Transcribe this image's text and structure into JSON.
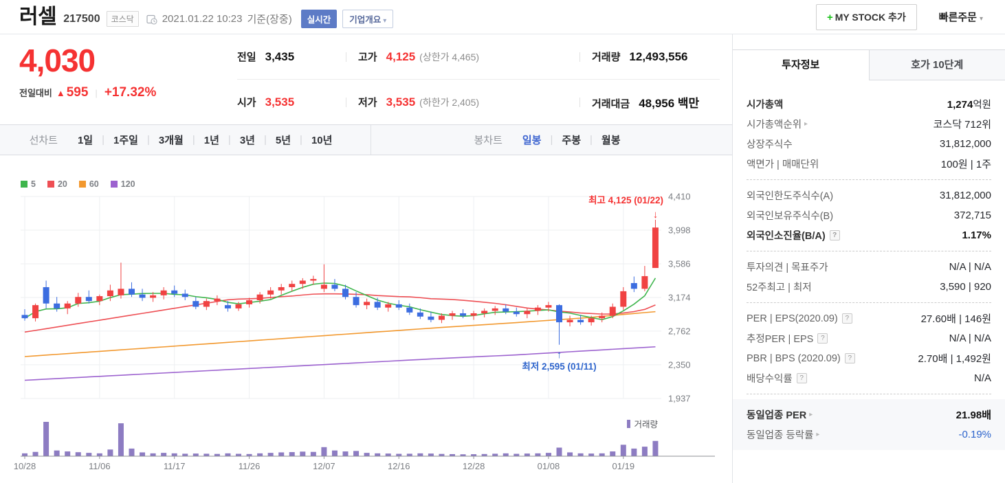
{
  "glyphs": {
    "caret": "▾",
    "plus": "+",
    "up_triangle": "▲",
    "pipe": "|",
    "arrow_right": "▸",
    "help": "?",
    "down_arrow": "↓",
    "up_arrow": "↑"
  },
  "header": {
    "stock_name": "러셀",
    "stock_code": "217500",
    "market_badge": "코스닥",
    "timestamp": "2021.01.22 10:23",
    "basis_label": "기준(장중)",
    "realtime_label": "실시간",
    "company_overview_label": "기업개요",
    "my_stock_label": "MY STOCK 추가",
    "quick_order_label": "빠른주문"
  },
  "price": {
    "current": "4,030",
    "change_label": "전일대비",
    "change_value": "595",
    "change_percent": "+17.32%",
    "color": "#f53232"
  },
  "summary": {
    "rows": [
      [
        {
          "key": "prev-close",
          "label": "전일",
          "value": "3,435",
          "tone": "dark"
        },
        {
          "key": "high",
          "label": "고가",
          "value": "4,125",
          "tone": "red",
          "extra": "(상한가 4,465)"
        },
        {
          "key": "volume",
          "label": "거래량",
          "value": "12,493,556",
          "tone": "dark"
        }
      ],
      [
        {
          "key": "open",
          "label": "시가",
          "value": "3,535",
          "tone": "red"
        },
        {
          "key": "low",
          "label": "저가",
          "value": "3,535",
          "tone": "red",
          "extra": "(하한가 2,405)"
        },
        {
          "key": "trade-value",
          "label": "거래대금",
          "value": "48,956 백만",
          "tone": "dark"
        }
      ]
    ]
  },
  "chart_tabs": {
    "period_group_label": "선차트",
    "periods": [
      "1일",
      "1주일",
      "3개월",
      "1년",
      "3년",
      "5년",
      "10년"
    ],
    "candle_group_label": "봉차트",
    "candle_types": [
      {
        "label": "일봉",
        "active": true
      },
      {
        "label": "주봉"
      },
      {
        "label": "월봉"
      }
    ]
  },
  "chart_data": {
    "type": "candlestick+volume",
    "title": "러셀 일봉 차트",
    "price_range": [
      1937,
      4410
    ],
    "y_ticks": [
      "4,410",
      "3,998",
      "3,586",
      "3,174",
      "2,762",
      "2,350",
      "1,937"
    ],
    "y_tick_values": [
      4410,
      3998,
      3586,
      3174,
      2762,
      2350,
      1937
    ],
    "x_ticks": [
      {
        "label": "10/28",
        "i": 0
      },
      {
        "label": "11/06",
        "i": 7
      },
      {
        "label": "11/17",
        "i": 14
      },
      {
        "label": "11/26",
        "i": 21
      },
      {
        "label": "12/07",
        "i": 28
      },
      {
        "label": "12/16",
        "i": 35
      },
      {
        "label": "12/28",
        "i": 42
      },
      {
        "label": "01/08",
        "i": 49
      },
      {
        "label": "01/19",
        "i": 56
      }
    ],
    "legend": [
      {
        "label": "5",
        "color": "#3eb54c"
      },
      {
        "label": "20",
        "color": "#ee4f54"
      },
      {
        "label": "60",
        "color": "#f2982e"
      },
      {
        "label": "120",
        "color": "#9c62cf"
      }
    ],
    "volume_legend": "거래량",
    "volume_color": "#8d7cc2",
    "up_color": "#f04242",
    "down_color": "#3c6de0",
    "ma20_start": 2750,
    "ma60_control": [
      2450,
      2510,
      2570,
      2630,
      2690,
      2750,
      2810,
      2865,
      2925,
      3000
    ],
    "ma120_control": [
      2160,
      2205,
      2250,
      2295,
      2340,
      2385,
      2430,
      2470,
      2520,
      2570
    ],
    "annotations": {
      "high": {
        "label": "최고 4,125 (01/22)",
        "index": 59,
        "price": 4125,
        "color": "#f53232"
      },
      "low": {
        "label": "최저 2,595 (01/11)",
        "index": 50,
        "price": 2595,
        "color": "#2d64cc"
      }
    },
    "candles": [
      [
        "10/28",
        2960,
        3030,
        2890,
        2920,
        300
      ],
      [
        "10/29",
        2920,
        3100,
        2880,
        3080,
        450
      ],
      [
        "10/30",
        3300,
        3380,
        3040,
        3100,
        3600
      ],
      [
        "11/02",
        3100,
        3180,
        3000,
        3040,
        600
      ],
      [
        "11/03",
        3040,
        3130,
        2970,
        3100,
        500
      ],
      [
        "11/04",
        3100,
        3230,
        3060,
        3180,
        420
      ],
      [
        "11/05",
        3180,
        3260,
        3100,
        3130,
        350
      ],
      [
        "11/06",
        3130,
        3210,
        3080,
        3190,
        300
      ],
      [
        "11/09",
        3190,
        3330,
        3130,
        3260,
        700
      ],
      [
        "11/10",
        3200,
        3600,
        3160,
        3280,
        3450
      ],
      [
        "11/11",
        3280,
        3360,
        3180,
        3210,
        800
      ],
      [
        "11/12",
        3210,
        3280,
        3130,
        3170,
        400
      ],
      [
        "11/13",
        3170,
        3240,
        3120,
        3200,
        300
      ],
      [
        "11/16",
        3200,
        3300,
        3150,
        3260,
        350
      ],
      [
        "11/17",
        3260,
        3320,
        3180,
        3220,
        300
      ],
      [
        "11/18",
        3220,
        3270,
        3140,
        3180,
        260
      ],
      [
        "11/19",
        3130,
        3180,
        3030,
        3060,
        280
      ],
      [
        "11/20",
        3060,
        3160,
        3020,
        3130,
        260
      ],
      [
        "11/23",
        3130,
        3200,
        3080,
        3160,
        240
      ],
      [
        "11/24",
        3080,
        3130,
        3000,
        3040,
        300
      ],
      [
        "11/25",
        3040,
        3120,
        3010,
        3090,
        250
      ],
      [
        "11/26",
        3090,
        3170,
        3050,
        3140,
        230
      ],
      [
        "11/27",
        3140,
        3240,
        3100,
        3210,
        300
      ],
      [
        "11/30",
        3210,
        3300,
        3160,
        3260,
        350
      ],
      [
        "12/01",
        3260,
        3340,
        3210,
        3300,
        400
      ],
      [
        "12/02",
        3300,
        3380,
        3250,
        3340,
        430
      ],
      [
        "12/03",
        3340,
        3410,
        3280,
        3380,
        480
      ],
      [
        "12/04",
        3380,
        3440,
        3330,
        3400,
        450
      ],
      [
        "12/07",
        3280,
        3580,
        3240,
        3330,
        950
      ],
      [
        "12/08",
        3330,
        3400,
        3250,
        3280,
        600
      ],
      [
        "12/09",
        3280,
        3330,
        3150,
        3180,
        500
      ],
      [
        "12/10",
        3180,
        3240,
        3050,
        3080,
        550
      ],
      [
        "12/11",
        3080,
        3160,
        3030,
        3120,
        350
      ],
      [
        "12/14",
        3120,
        3170,
        3020,
        3050,
        300
      ],
      [
        "12/15",
        3050,
        3120,
        3000,
        3090,
        280
      ],
      [
        "12/16",
        3090,
        3140,
        3020,
        3050,
        250
      ],
      [
        "12/17",
        3050,
        3100,
        2960,
        2990,
        260
      ],
      [
        "12/18",
        2990,
        3040,
        2910,
        2940,
        300
      ],
      [
        "12/21",
        2940,
        3000,
        2870,
        2900,
        280
      ],
      [
        "12/22",
        2900,
        2980,
        2860,
        2950,
        240
      ],
      [
        "12/23",
        2950,
        3010,
        2900,
        2980,
        220
      ],
      [
        "12/24",
        2980,
        3030,
        2920,
        2950,
        200
      ],
      [
        "12/28",
        2950,
        3010,
        2900,
        2980,
        210
      ],
      [
        "12/29",
        2980,
        3040,
        2930,
        3010,
        230
      ],
      [
        "12/30",
        3010,
        3070,
        2960,
        3040,
        260
      ],
      [
        "01/04",
        3040,
        3090,
        2970,
        3000,
        300
      ],
      [
        "01/05",
        3000,
        3050,
        2940,
        2970,
        250
      ],
      [
        "01/06",
        2970,
        3040,
        2920,
        3010,
        280
      ],
      [
        "01/07",
        3010,
        3080,
        2960,
        3050,
        300
      ],
      [
        "01/08",
        3050,
        3120,
        3000,
        3080,
        350
      ],
      [
        "01/11",
        3080,
        3090,
        2595,
        2870,
        900
      ],
      [
        "01/12",
        2870,
        2950,
        2820,
        2900,
        400
      ],
      [
        "01/13",
        2900,
        2960,
        2840,
        2870,
        300
      ],
      [
        "01/14",
        2870,
        2950,
        2830,
        2920,
        280
      ],
      [
        "01/15",
        2920,
        2990,
        2870,
        2950,
        300
      ],
      [
        "01/18",
        2950,
        3100,
        2920,
        3060,
        500
      ],
      [
        "01/19",
        3060,
        3300,
        3020,
        3250,
        1200
      ],
      [
        "01/20",
        3350,
        3430,
        3240,
        3280,
        800
      ],
      [
        "01/21",
        3280,
        3560,
        3250,
        3435,
        1000
      ],
      [
        "01/22",
        3535,
        4125,
        3535,
        4030,
        1600
      ]
    ]
  },
  "panel": {
    "tabs": [
      "투자정보",
      "호가 10단계"
    ],
    "sections": [
      [
        {
          "label": "시가총액",
          "label_bold": true,
          "value": "1,274",
          "suffix": "억원",
          "value_bold": true
        },
        {
          "label": "시가총액순위",
          "arrow": true,
          "value": "코스닥 712위"
        },
        {
          "label": "상장주식수",
          "value": "31,812,000"
        },
        {
          "label": "액면가 | 매매단위",
          "value": "100원 | 1주"
        }
      ],
      [
        {
          "label": "외국인한도주식수(A)",
          "value": "31,812,000"
        },
        {
          "label": "외국인보유주식수(B)",
          "value": "372,715"
        },
        {
          "label": "외국인소진율(B/A)",
          "label_bold": true,
          "help": true,
          "value": "1.17%",
          "value_bold": true
        }
      ],
      [
        {
          "label": "투자의견 | 목표주가",
          "value": "N/A | N/A"
        },
        {
          "label": "52주최고 | 최저",
          "value": "3,590 | 920"
        }
      ],
      [
        {
          "label": "PER | EPS(2020.09)",
          "help": true,
          "value": "27.60배 | 146원"
        },
        {
          "label": "추정PER | EPS",
          "help": true,
          "value": "N/A | N/A"
        },
        {
          "label": "PBR | BPS (2020.09)",
          "help": true,
          "value": "2.70배 | 1,492원"
        },
        {
          "label": "배당수익률",
          "help": true,
          "value": "N/A"
        }
      ]
    ],
    "industry_rows": [
      {
        "label": "동일업종 PER",
        "label_bold": true,
        "arrow": true,
        "value": "21.98배",
        "value_bold": true
      },
      {
        "label": "동일업종 등락률",
        "arrow": true,
        "value": "-0.19%",
        "value_blue": true
      }
    ]
  }
}
